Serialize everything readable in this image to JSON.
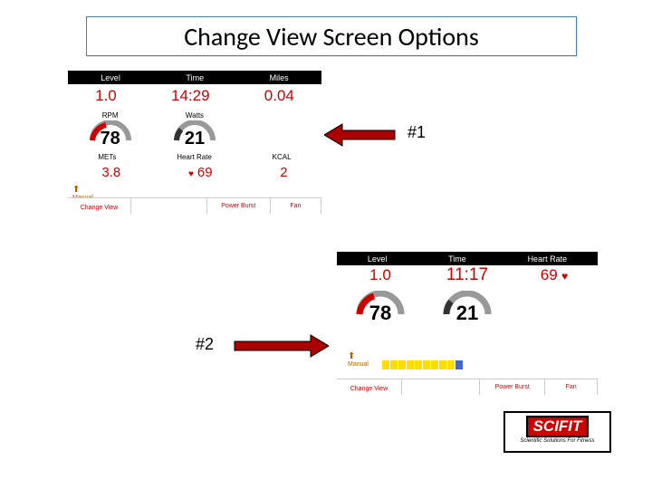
{
  "title": "Change View Screen Options",
  "panel1": {
    "headers": [
      "Level",
      "Time",
      "Miles"
    ],
    "values": [
      "1.0",
      "14:29",
      "0.04"
    ],
    "gauges": [
      {
        "label": "RPM",
        "value": "78"
      },
      {
        "label": "Watts",
        "value": "21"
      }
    ],
    "sub_headers": [
      "METs",
      "Heart Rate",
      "KCAL"
    ],
    "sub_values": [
      "3.8",
      "69",
      "2"
    ],
    "manual": "Manual",
    "buttons": {
      "change_view": "Change View",
      "power_burst": "Power Burst",
      "fan": "Fan"
    }
  },
  "panel2": {
    "headers": [
      "Level",
      "Time",
      "Heart Rate"
    ],
    "level": "1.0",
    "time": "11:17",
    "hr": "69",
    "gauge1": "78",
    "gauge2": "21",
    "manual": "Manual",
    "buttons": {
      "change_view": "Change View",
      "power_burst": "Power Burst",
      "fan": "Fan"
    }
  },
  "labels": {
    "n1": "#1",
    "n2": "#2"
  },
  "logo": {
    "main": "SCIFIT",
    "sub": "Scientific Solutions For Fitness"
  }
}
